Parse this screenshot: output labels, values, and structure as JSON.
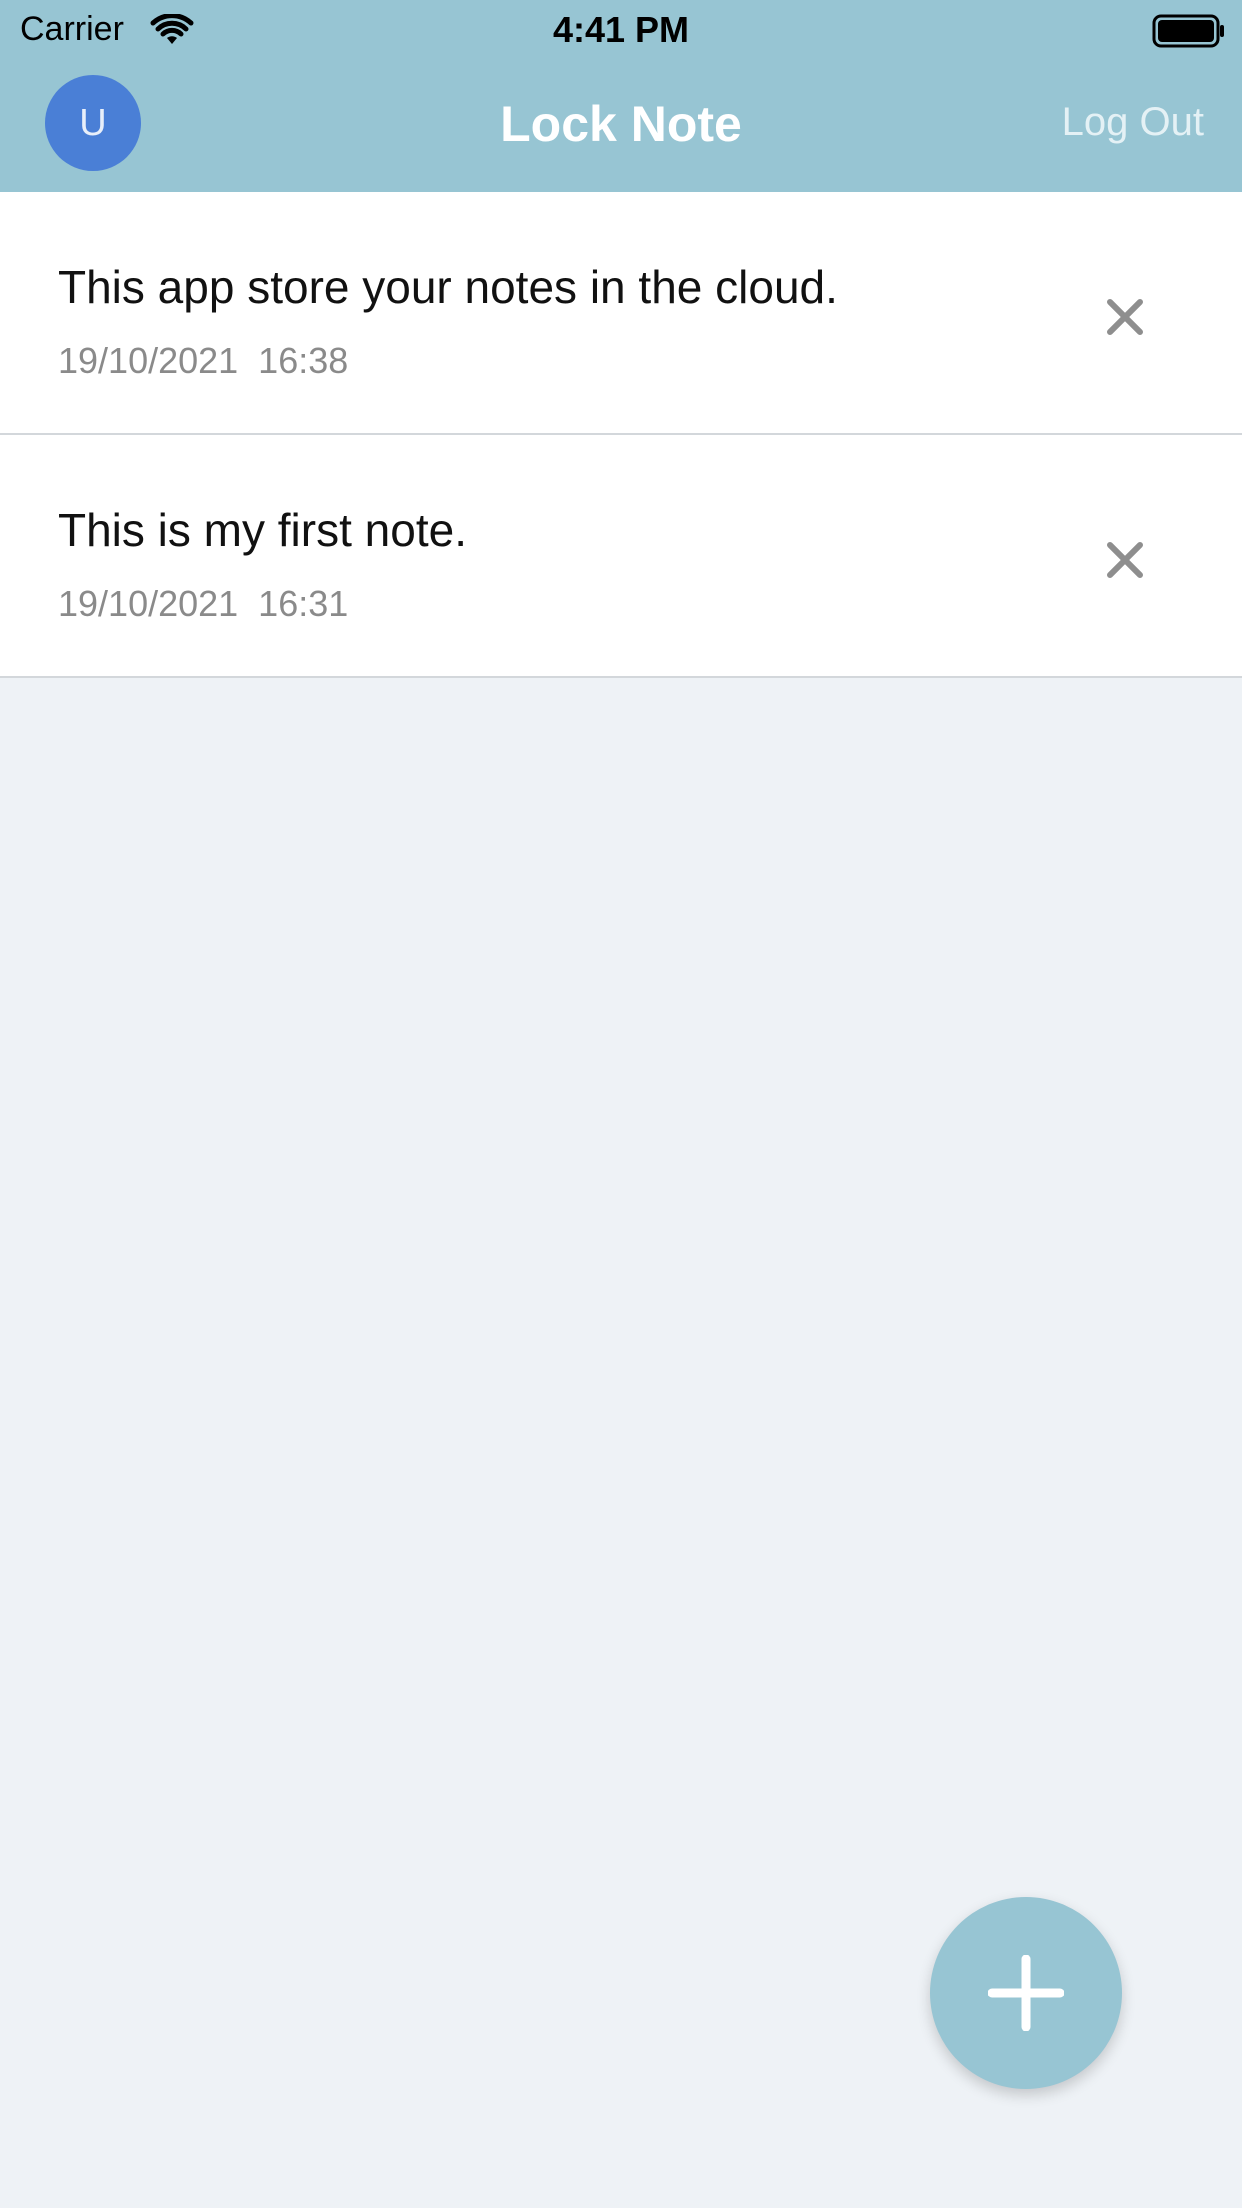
{
  "status_bar": {
    "carrier": "Carrier",
    "time": "4:41 PM",
    "wifi_icon": "wifi-icon",
    "battery_icon": "battery-icon"
  },
  "header": {
    "avatar_letter": "U",
    "title": "Lock Note",
    "logout_label": "Log Out"
  },
  "notes": [
    {
      "text": "This app store your notes in the cloud.",
      "date": "19/10/2021  16:38",
      "delete_icon": "close-icon"
    },
    {
      "text": "This is my first note.",
      "date": "19/10/2021  16:31",
      "delete_icon": "close-icon"
    }
  ],
  "fab": {
    "icon": "plus-icon"
  },
  "colors": {
    "header": "#97c5d3",
    "avatar": "#4a7fd6",
    "background": "#eef2f6",
    "fab": "#97c5d3"
  }
}
